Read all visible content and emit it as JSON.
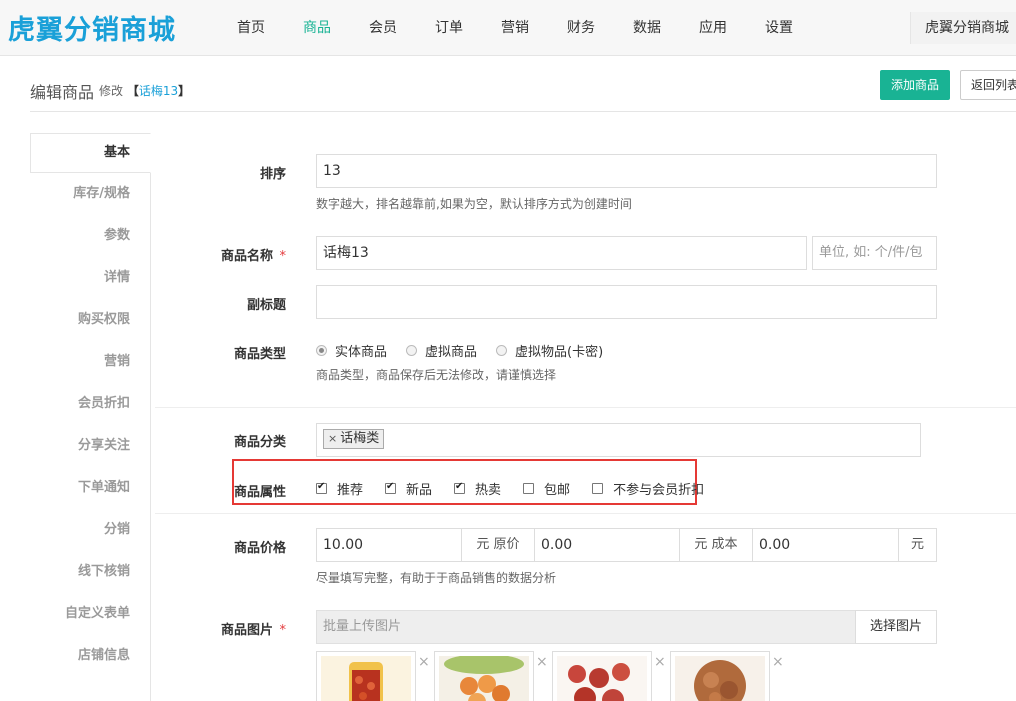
{
  "brand": {
    "logo_text": "虎翼分销商城"
  },
  "nav": {
    "items": [
      "首页",
      "商品",
      "会员",
      "订单",
      "营销",
      "财务",
      "数据",
      "应用",
      "设置"
    ],
    "active_index": 1,
    "user_menu": "虎翼分销商城"
  },
  "header": {
    "title": "编辑商品",
    "sub_label": "修改",
    "product_name": "话梅13",
    "add_button": "添加商品",
    "back_button": "返回列表"
  },
  "side_tabs": [
    "基本",
    "库存/规格",
    "参数",
    "详情",
    "购买权限",
    "营销",
    "会员折扣",
    "分享关注",
    "下单通知",
    "分销",
    "线下核销",
    "自定义表单",
    "店铺信息"
  ],
  "form": {
    "sort": {
      "label": "排序",
      "value": "13",
      "help": "数字越大，排名越靠前,如果为空，默认排序方式为创建时间"
    },
    "name": {
      "label": "商品名称",
      "required": "*",
      "value": "话梅13",
      "unit_placeholder": "单位, 如: 个/件/包"
    },
    "subtitle": {
      "label": "副标题",
      "value": ""
    },
    "type": {
      "label": "商品类型",
      "options": [
        {
          "label": "实体商品",
          "checked": true
        },
        {
          "label": "虚拟商品",
          "checked": false
        },
        {
          "label": "虚拟物品(卡密)",
          "checked": false
        }
      ],
      "help": "商品类型，商品保存后无法修改，请谨慎选择"
    },
    "category": {
      "label": "商品分类",
      "tag_remove": "×",
      "tag": "话梅类"
    },
    "attributes": {
      "label": "商品属性",
      "options": [
        {
          "label": "推荐",
          "checked": true
        },
        {
          "label": "新品",
          "checked": true
        },
        {
          "label": "热卖",
          "checked": true
        },
        {
          "label": "包邮",
          "checked": false
        },
        {
          "label": "不参与会员折扣",
          "checked": false
        }
      ]
    },
    "price": {
      "label": "商品价格",
      "price": "10.00",
      "unit_original": "元 原价",
      "original": "0.00",
      "unit_cost": "元 成本",
      "cost": "0.00",
      "unit": "元",
      "help": "尽量填写完整，有助于于商品销售的数据分析"
    },
    "images": {
      "label": "商品图片",
      "required": "*",
      "placeholder": "批量上传图片",
      "button": "选择图片",
      "remove": "×"
    }
  },
  "colors": {
    "accent": "#19b394",
    "brand_blue": "#1aa0d8",
    "brand_orange": "#f5a623",
    "highlight": "#e53935",
    "required": "#e4393c"
  }
}
